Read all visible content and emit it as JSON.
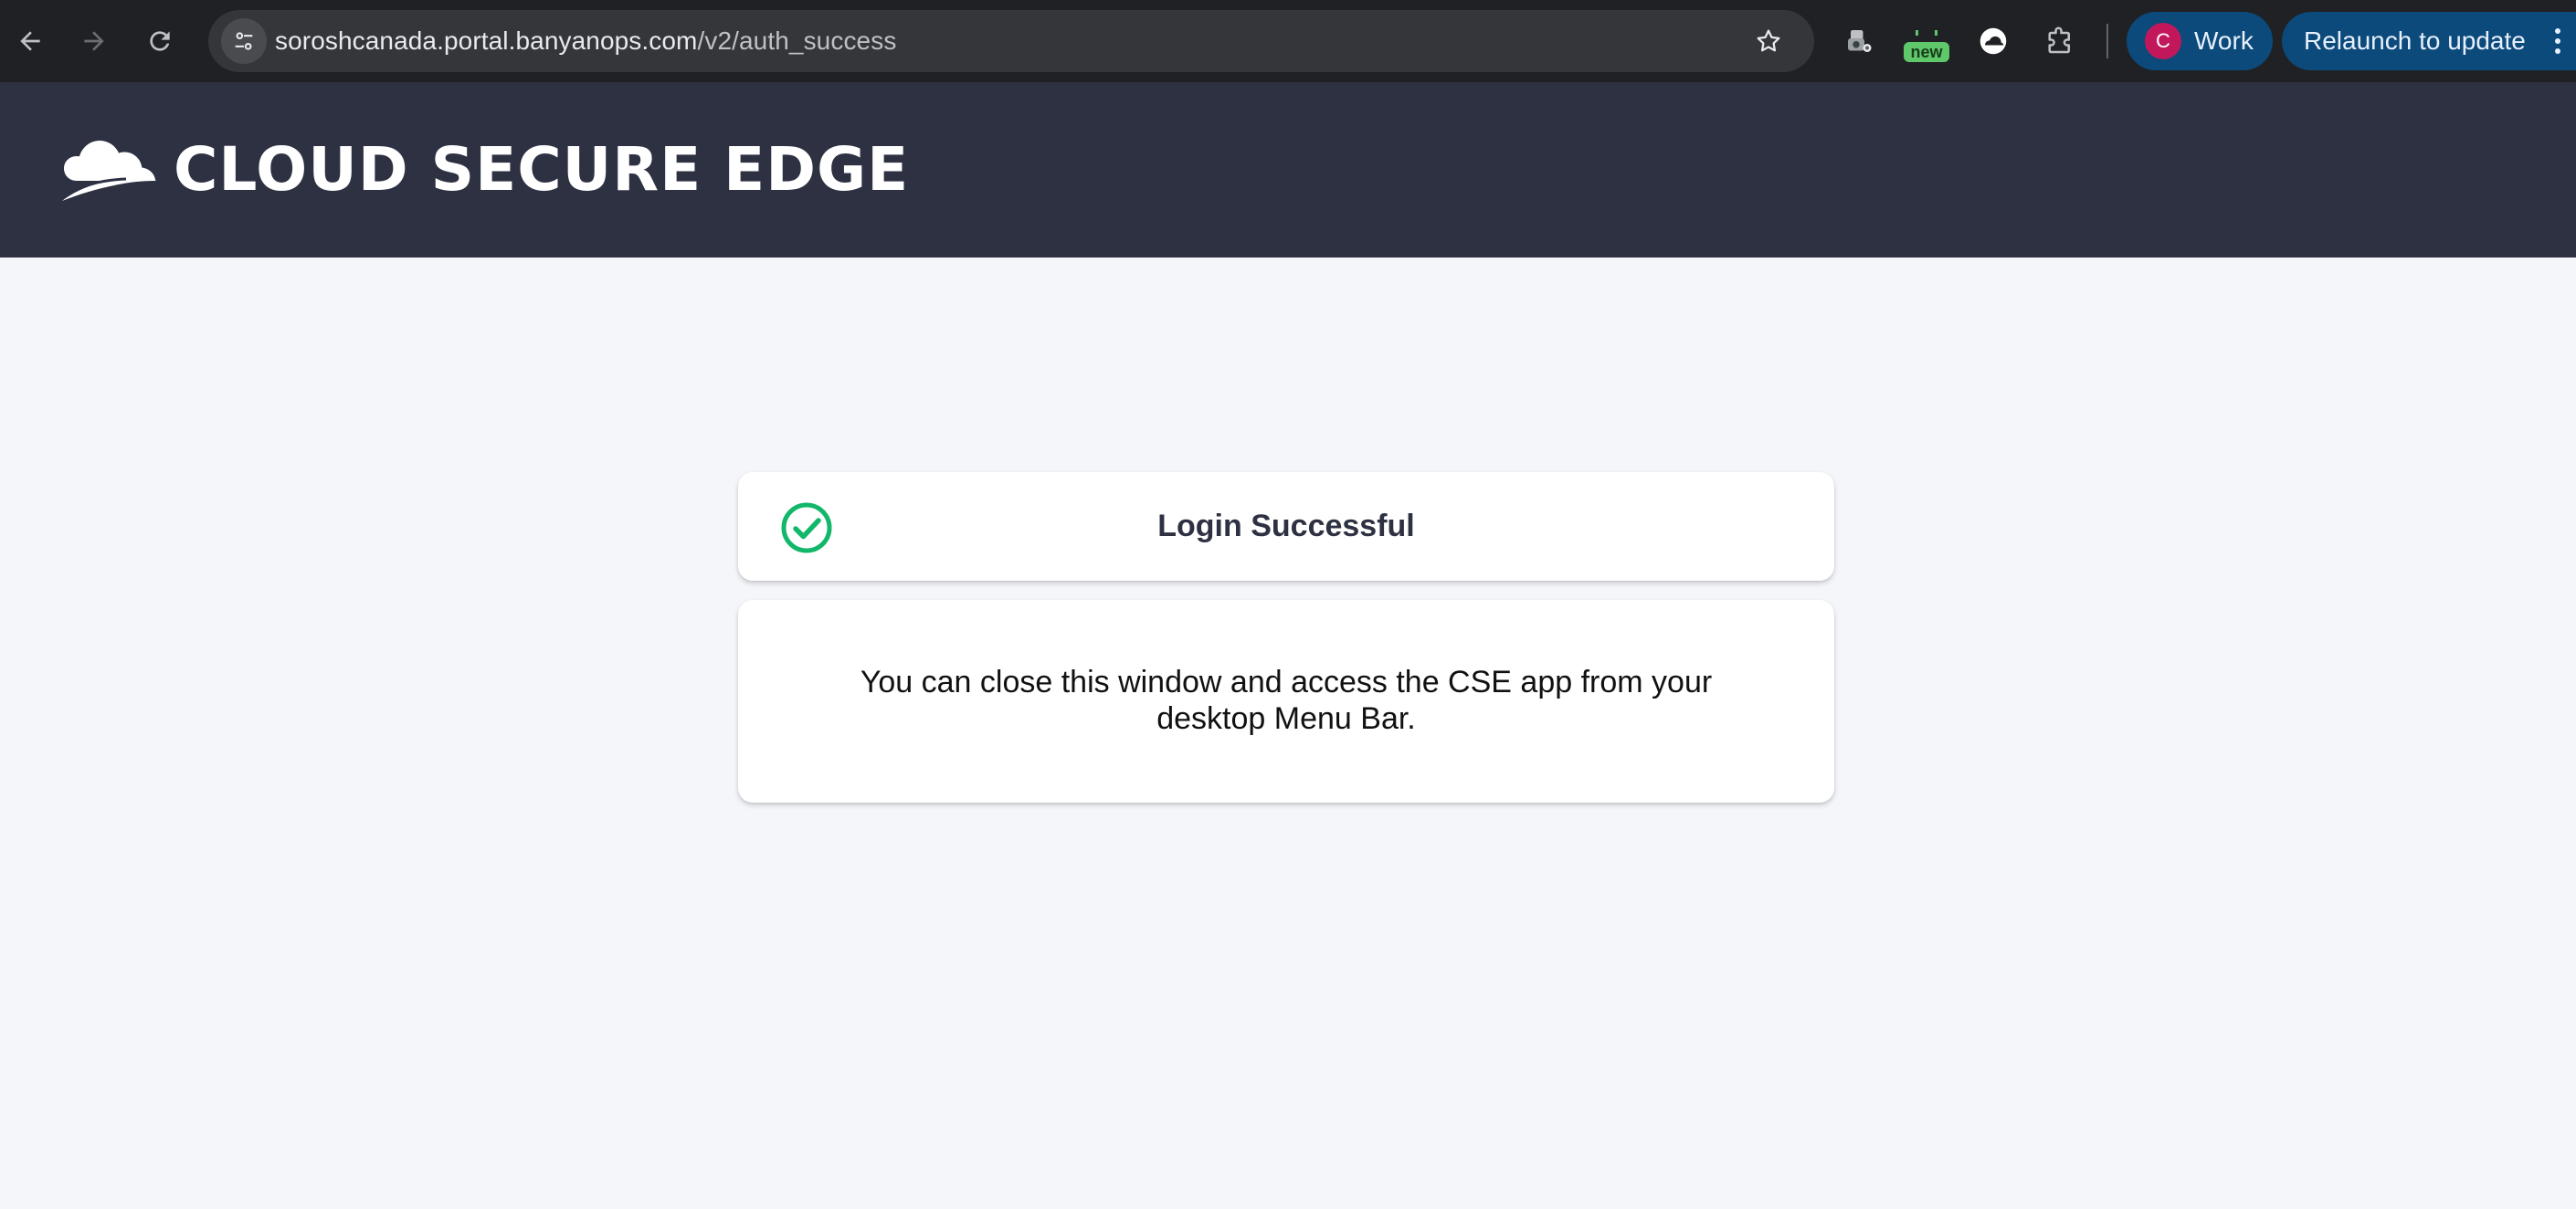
{
  "browser": {
    "url_host": "soroshcanada.portal.banyanops.com",
    "url_path": "/v2/auth_success",
    "extension_badge": "new",
    "profile": {
      "initial": "C",
      "name": "Work"
    },
    "relaunch_label": "Relaunch to update"
  },
  "header": {
    "brand_title": "CLOUD SECURE EDGE"
  },
  "status": {
    "title": "Login Successful"
  },
  "message": {
    "text": "You can close this window and access the CSE app from your desktop Menu Bar."
  },
  "icons": {
    "back": "back-arrow-icon",
    "forward": "forward-arrow-icon",
    "reload": "reload-icon",
    "site_info": "tune-icon",
    "bookmark": "star-icon",
    "extensions": "puzzle-icon",
    "success": "check-circle-icon"
  },
  "colors": {
    "header_bg": "#2d3142",
    "page_bg": "#f4f6fa",
    "success_green": "#12b76a",
    "profile_chip": "#0b4a7a",
    "avatar": "#c2185b"
  }
}
